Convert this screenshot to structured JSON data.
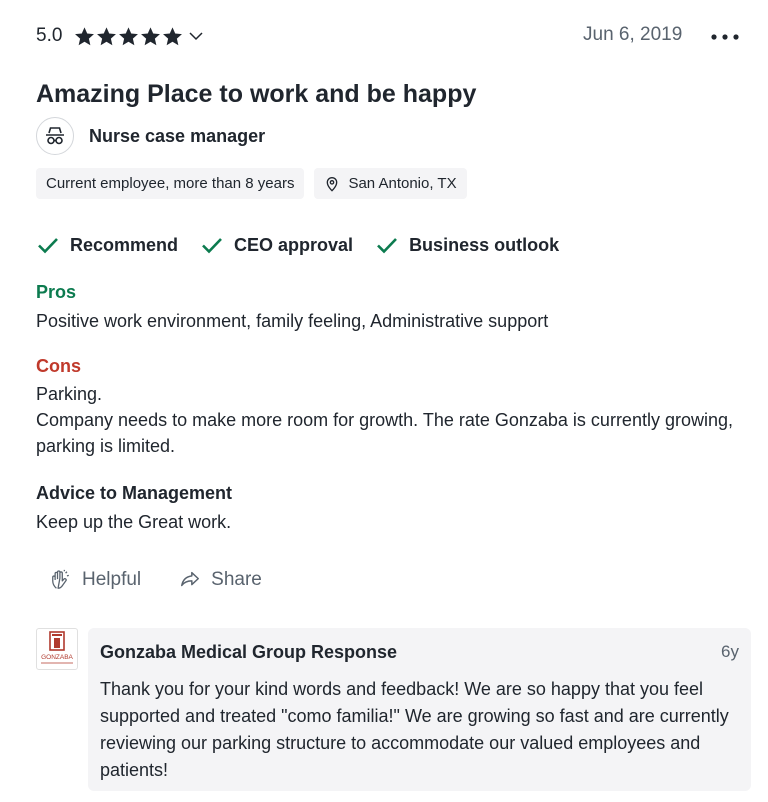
{
  "review": {
    "rating": "5.0",
    "stars": 5,
    "date": "Jun 6, 2019",
    "title": "Amazing Place to work and be happy",
    "role": "Nurse case manager",
    "employment": "Current employee, more than 8 years",
    "location": "San Antonio, TX",
    "approvals": {
      "recommend": "Recommend",
      "ceo": "CEO approval",
      "outlook": "Business outlook"
    },
    "pros_label": "Pros",
    "pros": "Positive work environment, family feeling, Administrative support",
    "cons_label": "Cons",
    "cons_line1": "Parking.",
    "cons_line2": "Company needs to make more room for growth. The rate Gonzaba is currently growing, parking is limited.",
    "advice_label": "Advice to Management",
    "advice": "Keep up the Great work."
  },
  "actions": {
    "helpful": "Helpful",
    "share": "Share"
  },
  "response": {
    "logo_text": "GONZABA",
    "title": "Gonzaba Medical Group Response",
    "age": "6y",
    "text": "Thank you for your kind words and feedback! We are so happy that you feel supported and treated \"como familia!\" We are growing so fast and are currently reviewing our parking structure to accommodate our valued employees and patients!"
  },
  "colors": {
    "pros": "#0c7b4f",
    "cons": "#c0392b",
    "check": "#0c7b4f",
    "text": "#20262e",
    "muted": "#59636e",
    "chip_bg": "#f4f4f6"
  },
  "icons": [
    "star-icon",
    "chevron-down-icon",
    "more-options-icon",
    "role-glasses-icon",
    "location-pin-icon",
    "check-icon",
    "helpful-hand-icon",
    "share-icon"
  ]
}
